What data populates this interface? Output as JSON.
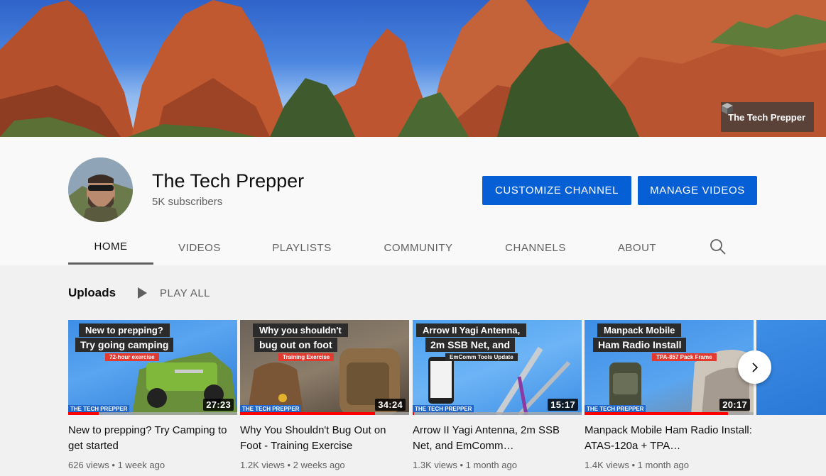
{
  "banner": {
    "link_label": "The Tech Prepper"
  },
  "channel": {
    "name": "The Tech Prepper",
    "subscribers": "5K subscribers",
    "customize_label": "CUSTOMIZE CHANNEL",
    "manage_label": "MANAGE VIDEOS"
  },
  "tabs": [
    {
      "label": "HOME",
      "active": true
    },
    {
      "label": "VIDEOS"
    },
    {
      "label": "PLAYLISTS"
    },
    {
      "label": "COMMUNITY"
    },
    {
      "label": "CHANNELS"
    },
    {
      "label": "ABOUT"
    }
  ],
  "shelf": {
    "title": "Uploads",
    "play_all": "PLAY ALL"
  },
  "videos": [
    {
      "thumb_line1": "New to prepping?",
      "thumb_line2": "Try going camping",
      "thumb_tag": "72-hour exercise",
      "brand": "THE TECH PREPPER",
      "duration": "27:23",
      "progress": 0.18,
      "title": "New to prepping? Try Camping to get started",
      "views": "626 views",
      "age": "1 week ago"
    },
    {
      "thumb_line1": "Why you shouldn't",
      "thumb_line2": "bug out on foot",
      "thumb_tag": "Training Exercise",
      "brand": "THE TECH PREPPER",
      "duration": "34:24",
      "progress": 0.8,
      "title": "Why You Shouldn't Bug Out on Foot - Training Exercise",
      "views": "1.2K views",
      "age": "2 weeks ago"
    },
    {
      "thumb_line1": "Arrow II Yagi Antenna,",
      "thumb_line2": "2m SSB Net, and",
      "thumb_tag": "EmComm Tools Update",
      "brand": "THE TECH PREPPER",
      "duration": "15:17",
      "progress": 0.01,
      "title": "Arrow II Yagi Antenna, 2m SSB Net, and EmComm…",
      "views": "1.3K views",
      "age": "1 month ago"
    },
    {
      "thumb_line1": "Manpack Mobile",
      "thumb_line2": "Ham Radio Install",
      "thumb_tag": "TPA-857 Pack Frame",
      "brand": "THE TECH PREPPER",
      "duration": "20:17",
      "progress": 0.85,
      "title": "Manpack Mobile Ham Radio Install: ATAS-120a + TPA…",
      "views": "1.4K views",
      "age": "1 month ago"
    }
  ],
  "colors": {
    "accent": "#065fd4",
    "progress": "#ff0000"
  }
}
